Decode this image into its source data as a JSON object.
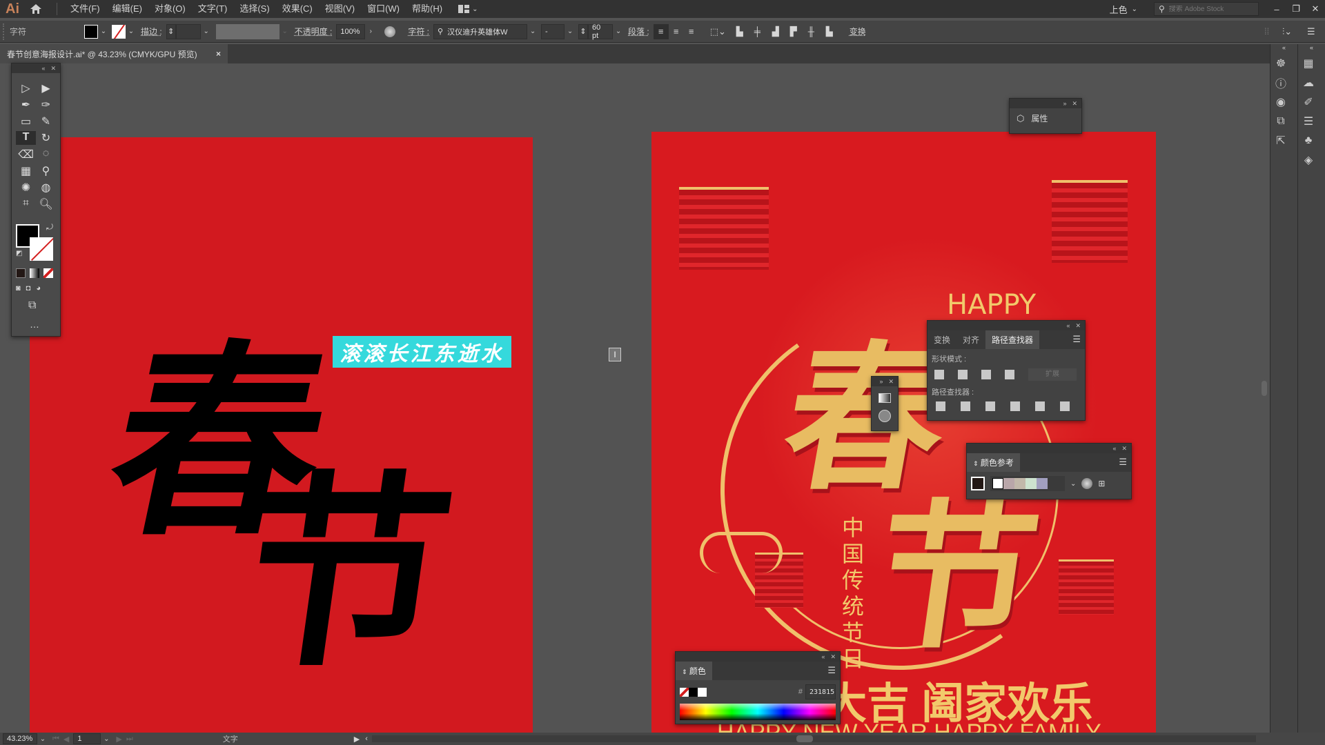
{
  "app": {
    "logo": "Ai",
    "title": "Adobe Illustrator"
  },
  "menu": [
    "文件(F)",
    "编辑(E)",
    "对象(O)",
    "文字(T)",
    "选择(S)",
    "效果(C)",
    "视图(V)",
    "窗口(W)",
    "帮助(H)"
  ],
  "topright": {
    "workspace": "上色",
    "search_placeholder": "搜索 Adobe Stock"
  },
  "control": {
    "section": "字符",
    "stroke_label": "描边 :",
    "opacity_label": "不透明度 :",
    "opacity_value": "100%",
    "char_label": "字符 :",
    "font_name": "汉仪迪升英雄体W",
    "font_style": "-",
    "font_size": "60 pt",
    "para_label": "段落 :",
    "transform_label": "变换"
  },
  "document_tab": {
    "title": "春节创意海报设计.ai* @ 43.23% (CMYK/GPU 预览)",
    "close": "×"
  },
  "artboard_left": {
    "big_char1": "春",
    "big_char2": "节",
    "selected_text": "滚滚长江东逝水",
    "selection_color": "#35d9dc"
  },
  "artboard_right": {
    "happy": "HAPPY",
    "title1": "春",
    "title2": "节",
    "vertical_text": "中国传统节日",
    "bottom_text": "大吉 阖家欢乐",
    "bottom_english": "HAPPY NEW YEAR HAPPY FAMILY",
    "bg_color": "#d81a1f",
    "gold_color": "#f2c96b"
  },
  "panels": {
    "properties": {
      "label": "属性"
    },
    "pathfinder": {
      "tabs": [
        "变换",
        "对齐",
        "路径查找器"
      ],
      "active_tab": "路径查找器",
      "shape_modes_label": "形状模式 :",
      "expand_label": "扩展",
      "pathfinders_label": "路径查找器 :"
    },
    "color_guide": {
      "title": "颜色参考",
      "swatches": [
        "#ffffff",
        "#b9a6a9",
        "#c2b8aa",
        "#cde3cf",
        "#a19fbf"
      ]
    },
    "color": {
      "title": "颜色",
      "hex_prefix": "#",
      "hex_value": "231815"
    }
  },
  "status": {
    "zoom": "43.23%",
    "artboard_num": "1",
    "tool": "文字"
  }
}
